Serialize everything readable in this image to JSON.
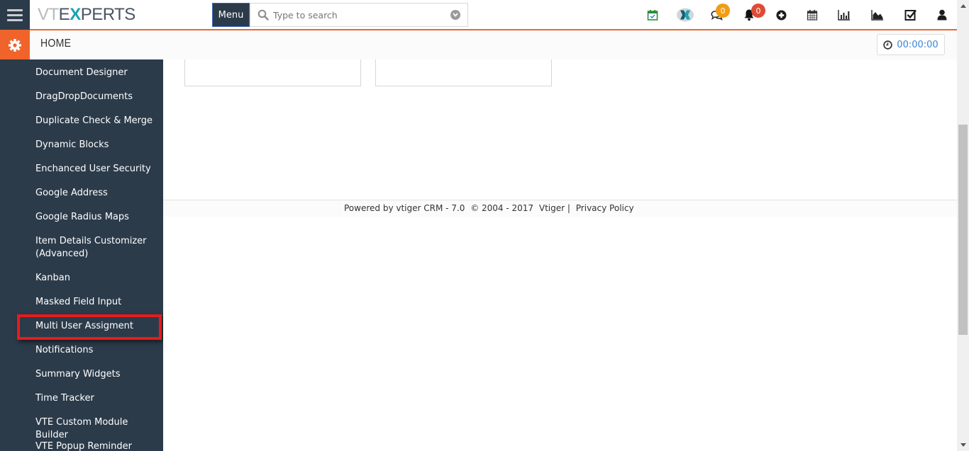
{
  "header": {
    "logo": {
      "part1": "VT",
      "part2": "E",
      "x": "X",
      "rest": "PERTS"
    },
    "menu_label": "Menu",
    "search": {
      "placeholder": "Type to search",
      "value": ""
    },
    "icons": [
      {
        "name": "calendar-check-icon",
        "color": "#2e9e3e"
      },
      {
        "name": "vtexperts-x-icon",
        "color": "#1aa3b2"
      },
      {
        "name": "comments-icon",
        "badge": "0",
        "badge_color": "#f39c12"
      },
      {
        "name": "bell-icon",
        "badge": "0",
        "badge_color": "#e04b35"
      },
      {
        "name": "plus-circle-icon"
      },
      {
        "name": "calendar-icon"
      },
      {
        "name": "bar-chart-icon"
      },
      {
        "name": "area-chart-icon"
      },
      {
        "name": "task-checkbox-icon"
      },
      {
        "name": "user-icon"
      }
    ],
    "accent_color": "#e9682b"
  },
  "subheader": {
    "title": "HOME",
    "timer": "00:00:00",
    "settings_color": "#f0632a"
  },
  "sidebar": {
    "items": [
      {
        "label": "Document Designer"
      },
      {
        "label": "DragDropDocuments"
      },
      {
        "label": "Duplicate Check & Merge"
      },
      {
        "label": "Dynamic Blocks"
      },
      {
        "label": "Enchanced User Security"
      },
      {
        "label": "Google Address"
      },
      {
        "label": "Google Radius Maps"
      },
      {
        "label": "Item Details Customizer (Advanced)"
      },
      {
        "label": "Kanban"
      },
      {
        "label": "Masked Field Input"
      },
      {
        "label": "Multi User Assigment",
        "highlighted": true
      },
      {
        "label": "Notifications"
      },
      {
        "label": "Summary Widgets"
      },
      {
        "label": "Time Tracker"
      },
      {
        "label": "VTE Custom Module Builder"
      },
      {
        "label": "VTE Popup Reminder"
      }
    ],
    "highlight_color": "#e81b1b"
  },
  "footer": {
    "powered": "Powered by vtiger CRM - 7.0",
    "copyright": "© 2004 - 2017",
    "vtiger_link": "Vtiger",
    "separator": "|",
    "privacy_link": "Privacy Policy"
  },
  "scroll": {
    "position_fraction": 0.52
  }
}
